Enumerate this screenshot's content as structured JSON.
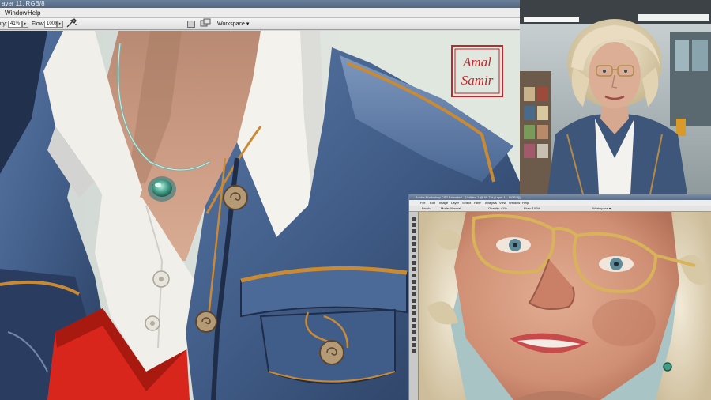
{
  "main_window": {
    "title_fragment": "ayer 11, RGB/8",
    "menu": [
      "Window",
      "Help"
    ],
    "options": {
      "opacity_label": "ity:",
      "opacity_value": "41%",
      "flow_label": "Flow:",
      "flow_value": "100%",
      "workspace_label": "Workspace ▾"
    }
  },
  "small_window": {
    "title_text": "Adobe Photoshop CS3 Extended - [Untitled-1 @ 66.7% (Layer 11, RGB/8)]",
    "menu": [
      "File",
      "Edit",
      "Image",
      "Layer",
      "Select",
      "Filter",
      "Analysis",
      "View",
      "Window",
      "Help"
    ],
    "options_brush_label": "Brush:",
    "options_mode_label": "Mode: Normal",
    "options_opacity_label": "Opacity: 41%",
    "options_flow_label": "Flow: 100%",
    "options_workspace_label": "Workspace ▾"
  },
  "canvas_art": {
    "signature": "Amal Samir"
  },
  "colors": {
    "denim": "#3f5b86",
    "denim_dark": "#1e2c46",
    "shirt_white": "#f1efe9",
    "sweater_red": "#d8261c",
    "skin": "#cf9e86",
    "stitch_orange": "#c98a36",
    "signature_red": "#c0262b"
  },
  "icons": [
    "dropdown-arrow-icon",
    "airbrush-icon",
    "palette-well-icon",
    "tool-preset-icon"
  ]
}
